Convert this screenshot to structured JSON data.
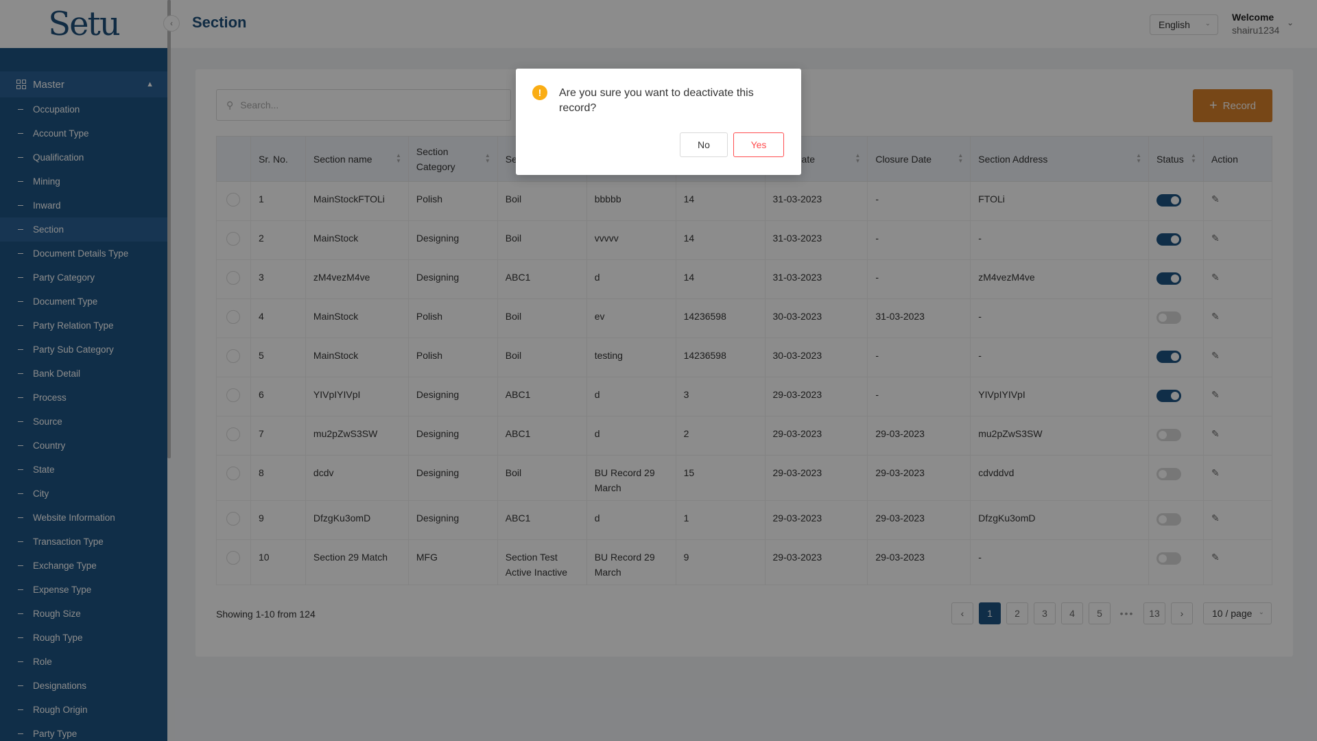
{
  "app": {
    "logo_text": "Setu",
    "page_title": "Section",
    "language": "English",
    "welcome_label": "Welcome",
    "username": "shairu1234"
  },
  "sidebar": {
    "group_label": "Master",
    "items": [
      {
        "label": "Occupation"
      },
      {
        "label": "Account Type"
      },
      {
        "label": "Qualification"
      },
      {
        "label": "Mining"
      },
      {
        "label": "Inward"
      },
      {
        "label": "Section",
        "active": true
      },
      {
        "label": "Document Details Type"
      },
      {
        "label": "Party Category"
      },
      {
        "label": "Document Type"
      },
      {
        "label": "Party Relation Type"
      },
      {
        "label": "Party Sub Category"
      },
      {
        "label": "Bank Detail"
      },
      {
        "label": "Process"
      },
      {
        "label": "Source"
      },
      {
        "label": "Country"
      },
      {
        "label": "State"
      },
      {
        "label": "City"
      },
      {
        "label": "Website Information"
      },
      {
        "label": "Transaction Type"
      },
      {
        "label": "Exchange Type"
      },
      {
        "label": "Expense Type"
      },
      {
        "label": "Rough Size"
      },
      {
        "label": "Rough Type"
      },
      {
        "label": "Role"
      },
      {
        "label": "Designations"
      },
      {
        "label": "Rough Origin"
      },
      {
        "label": "Party Type"
      }
    ]
  },
  "toolbar": {
    "search_placeholder": "Search...",
    "record_button": "Record"
  },
  "table": {
    "headers": [
      "Sr. No.",
      "Section name",
      "Section Category",
      "Se",
      "",
      "",
      "ered Date",
      "Closure Date",
      "Section Address",
      "Status",
      "Action"
    ],
    "rows": [
      {
        "sr": "1",
        "name": "MainStockFTOLi",
        "category": "Polish",
        "c3": "Boil",
        "c4": "bbbbb",
        "c5": "14",
        "date": "31-03-2023",
        "closure": "-",
        "address": "FTOLi",
        "status": true
      },
      {
        "sr": "2",
        "name": "MainStock",
        "category": "Designing",
        "c3": "Boil",
        "c4": "vvvvv",
        "c5": "14",
        "date": "31-03-2023",
        "closure": "-",
        "address": "-",
        "status": true
      },
      {
        "sr": "3",
        "name": "zM4vezM4ve",
        "category": "Designing",
        "c3": "ABC1",
        "c4": "d",
        "c5": "14",
        "date": "31-03-2023",
        "closure": "-",
        "address": "zM4vezM4ve",
        "status": true
      },
      {
        "sr": "4",
        "name": "MainStock",
        "category": "Polish",
        "c3": "Boil",
        "c4": "ev",
        "c5": "14236598",
        "date": "30-03-2023",
        "closure": "31-03-2023",
        "address": "-",
        "status": false
      },
      {
        "sr": "5",
        "name": "MainStock",
        "category": "Polish",
        "c3": "Boil",
        "c4": "testing",
        "c5": "14236598",
        "date": "30-03-2023",
        "closure": "-",
        "address": "-",
        "status": true
      },
      {
        "sr": "6",
        "name": "YIVpIYIVpI",
        "category": "Designing",
        "c3": "ABC1",
        "c4": "d",
        "c5": "3",
        "date": "29-03-2023",
        "closure": "-",
        "address": "YIVpIYIVpI",
        "status": true
      },
      {
        "sr": "7",
        "name": "mu2pZwS3SW",
        "category": "Designing",
        "c3": "ABC1",
        "c4": "d",
        "c5": "2",
        "date": "29-03-2023",
        "closure": "29-03-2023",
        "address": "mu2pZwS3SW",
        "status": false
      },
      {
        "sr": "8",
        "name": "dcdv",
        "category": "Designing",
        "c3": "Boil",
        "c4": "BU Record 29 March",
        "c5": "15",
        "date": "29-03-2023",
        "closure": "29-03-2023",
        "address": "cdvddvd",
        "status": false
      },
      {
        "sr": "9",
        "name": "DfzgKu3omD",
        "category": "Designing",
        "c3": "ABC1",
        "c4": "d",
        "c5": "1",
        "date": "29-03-2023",
        "closure": "29-03-2023",
        "address": "DfzgKu3omD",
        "status": false
      },
      {
        "sr": "10",
        "name": "Section 29 Match",
        "category": "MFG",
        "c3": "Section Test Active Inactive",
        "c4": "BU Record 29 March",
        "c5": "9",
        "date": "29-03-2023",
        "closure": "29-03-2023",
        "address": "-",
        "status": false
      }
    ]
  },
  "pagination": {
    "showing": "Showing 1-10 from 124",
    "pages": [
      "1",
      "2",
      "3",
      "4",
      "5"
    ],
    "ellipsis": "•••",
    "last_page": "13",
    "current": "1",
    "page_size": "10 / page"
  },
  "modal": {
    "message": "Are you sure you want to deactivate this record?",
    "no_label": "No",
    "yes_label": "Yes",
    "icon_glyph": "!"
  },
  "colors": {
    "brand_blue": "#1e5483",
    "accent_orange": "#d9822b",
    "warning": "#faad14",
    "danger": "#ff4d4f"
  }
}
